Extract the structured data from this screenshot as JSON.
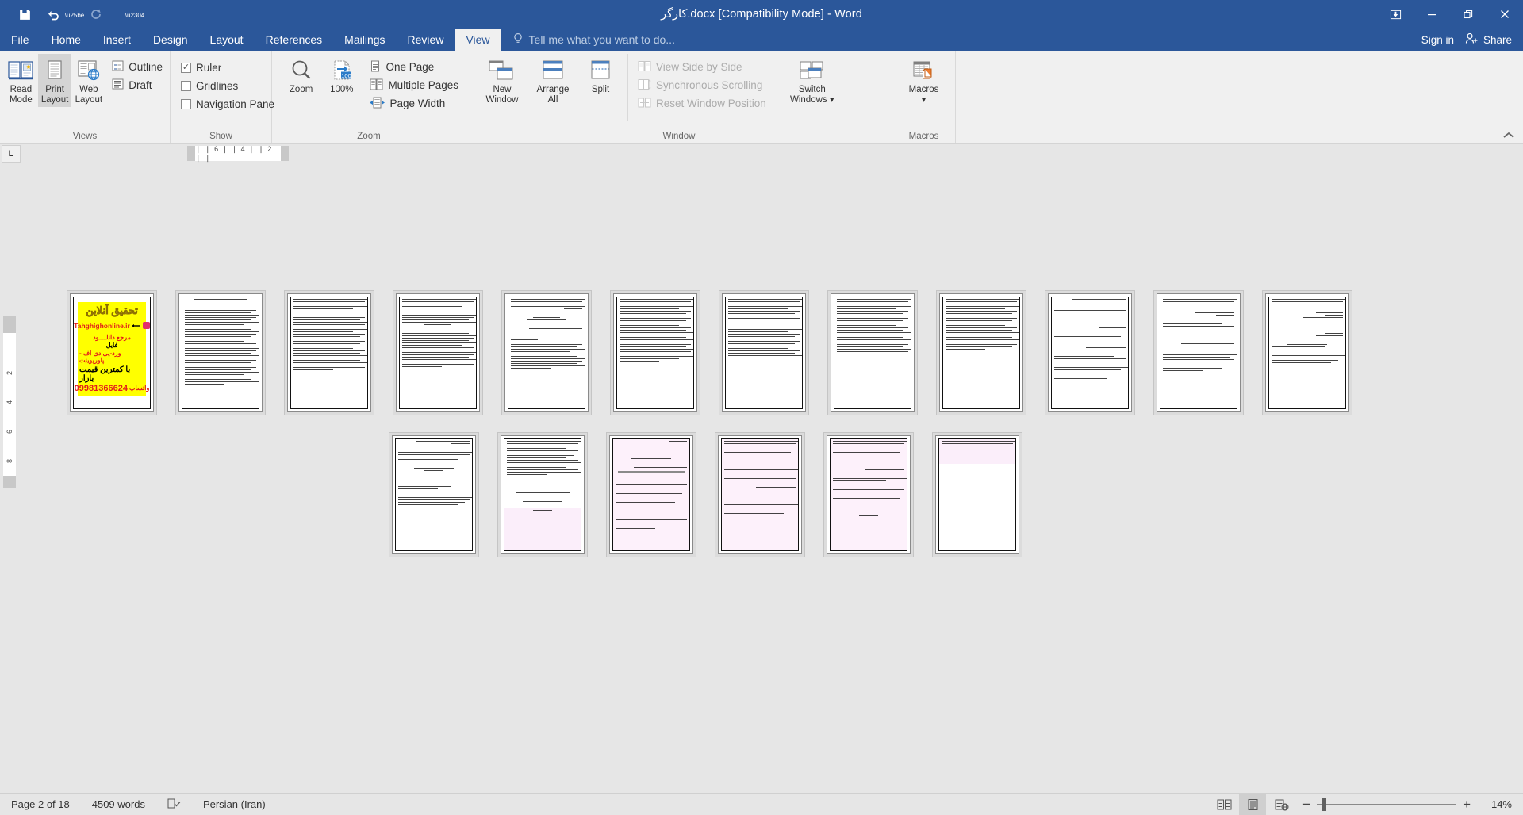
{
  "window": {
    "title": "کارگر.docx [Compatibility Mode] - Word",
    "quick_access": [
      {
        "name": "save",
        "glyph": "💾"
      },
      {
        "name": "undo",
        "glyph": "↶"
      },
      {
        "name": "redo",
        "glyph": "↻"
      },
      {
        "name": "customize",
        "glyph": "⌄"
      }
    ],
    "controls": {
      "ribbon_display_options": "⬆",
      "minimize": "—",
      "restore": "❐",
      "close": "✕"
    }
  },
  "tabs": [
    {
      "label": "File",
      "active": false
    },
    {
      "label": "Home",
      "active": false
    },
    {
      "label": "Insert",
      "active": false
    },
    {
      "label": "Design",
      "active": false
    },
    {
      "label": "Layout",
      "active": false
    },
    {
      "label": "References",
      "active": false
    },
    {
      "label": "Mailings",
      "active": false
    },
    {
      "label": "Review",
      "active": false
    },
    {
      "label": "View",
      "active": true
    }
  ],
  "tellme": {
    "placeholder": "Tell me what you want to do...",
    "icon": "lightbulb-icon"
  },
  "account": {
    "signin": "Sign in",
    "share": "Share"
  },
  "ribbon": {
    "collapse_glyph": "⌃",
    "groups": [
      {
        "label": "Views",
        "big_buttons": [
          {
            "label1": "Read",
            "label2": "Mode",
            "name": "read-mode",
            "selected": false
          },
          {
            "label1": "Print",
            "label2": "Layout",
            "name": "print-layout",
            "selected": true
          },
          {
            "label1": "Web",
            "label2": "Layout",
            "name": "web-layout",
            "selected": false
          }
        ],
        "small_items": [
          {
            "label": "Outline",
            "name": "outline",
            "type": "icon"
          },
          {
            "label": "Draft",
            "name": "draft",
            "type": "icon"
          }
        ]
      },
      {
        "label": "Show",
        "small_items": [
          {
            "label": "Ruler",
            "name": "ruler",
            "type": "check",
            "checked": true
          },
          {
            "label": "Gridlines",
            "name": "gridlines",
            "type": "check",
            "checked": false
          },
          {
            "label": "Navigation Pane",
            "name": "navigation-pane",
            "type": "check",
            "checked": false
          }
        ]
      },
      {
        "label": "Zoom",
        "big_buttons": [
          {
            "label1": "Zoom",
            "label2": "",
            "name": "zoom",
            "selected": false
          },
          {
            "label1": "100%",
            "label2": "",
            "name": "zoom-100",
            "selected": false
          }
        ],
        "small_items": [
          {
            "label": "One Page",
            "name": "one-page",
            "type": "icon"
          },
          {
            "label": "Multiple Pages",
            "name": "multiple-pages",
            "type": "icon"
          },
          {
            "label": "Page Width",
            "name": "page-width",
            "type": "icon"
          }
        ]
      },
      {
        "label": "Window",
        "big_buttons": [
          {
            "label1": "New",
            "label2": "Window",
            "name": "new-window",
            "selected": false
          },
          {
            "label1": "Arrange",
            "label2": "All",
            "name": "arrange-all",
            "selected": false
          },
          {
            "label1": "Split",
            "label2": "",
            "name": "split",
            "selected": false
          },
          {
            "label1": "Switch",
            "label2": "Windows ▾",
            "name": "switch-windows",
            "selected": false
          }
        ],
        "small_items": [
          {
            "label": "View Side by Side",
            "name": "view-side-by-side",
            "type": "icon",
            "disabled": true
          },
          {
            "label": "Synchronous Scrolling",
            "name": "synchronous-scrolling",
            "type": "icon",
            "disabled": true
          },
          {
            "label": "Reset Window Position",
            "name": "reset-window-position",
            "type": "icon",
            "disabled": true
          }
        ]
      },
      {
        "label": "Macros",
        "big_buttons": [
          {
            "label1": "Macros",
            "label2": "▾",
            "name": "macros",
            "selected": false
          }
        ],
        "small_items": []
      }
    ]
  },
  "rulers": {
    "tab_selector": "L",
    "horizontal_ticks": "❘ ❘ 6 ❘  ❘ 4 ❘  ❘ 2 ❘  ❘",
    "vertical_ticks": [
      "",
      "2",
      "4",
      "6",
      "8",
      ""
    ]
  },
  "document": {
    "zoom_percent": "14%",
    "rows": [
      {
        "pages": [
          {
            "n": 1,
            "kind": "ad",
            "selected": true
          },
          {
            "n": 2,
            "kind": "dense",
            "selected": true
          },
          {
            "n": 3,
            "kind": "dense",
            "selected": true
          },
          {
            "n": 4,
            "kind": "dense",
            "selected": true
          },
          {
            "n": 5,
            "kind": "dense",
            "selected": true
          },
          {
            "n": 6,
            "kind": "dense",
            "selected": true
          },
          {
            "n": 7,
            "kind": "dense",
            "selected": true
          },
          {
            "n": 8,
            "kind": "dense",
            "selected": true
          },
          {
            "n": 9,
            "kind": "dense",
            "selected": true
          },
          {
            "n": 10,
            "kind": "sparse",
            "selected": true
          },
          {
            "n": 11,
            "kind": "sparse",
            "selected": true
          },
          {
            "n": 12,
            "kind": "sparse",
            "selected": true
          }
        ]
      },
      {
        "pages": [
          {
            "n": 13,
            "kind": "sparse",
            "selected": true
          },
          {
            "n": 14,
            "kind": "tintedhalf",
            "selected": true
          },
          {
            "n": 15,
            "kind": "tinted",
            "selected": true
          },
          {
            "n": 16,
            "kind": "tinted",
            "selected": true
          },
          {
            "n": 17,
            "kind": "tinted",
            "selected": true
          },
          {
            "n": 18,
            "kind": "tintedtop",
            "selected": true
          }
        ]
      }
    ],
    "advertisement": {
      "headline": "تحقیق آنلاین",
      "url": "Tahghighonline.ir",
      "line1": "مرجع دانلــــود",
      "line2": "فایل",
      "line3": "ورد-پی دی اف - پاورپوینت",
      "line4": "با کمترین قیمت بازار",
      "phone": "09981366624",
      "whatsapp": "واتساپ"
    }
  },
  "status": {
    "page": "Page 2 of 18",
    "words": "4509 words",
    "proofing_icon": "proofing-icon",
    "language": "Persian (Iran)",
    "view_buttons": [
      {
        "name": "read-mode-view",
        "glyph": "☷",
        "active": false
      },
      {
        "name": "print-layout-view",
        "glyph": "▤",
        "active": true
      },
      {
        "name": "web-layout-view",
        "glyph": "ἱ0",
        "active": false
      }
    ],
    "zoom_out": "−",
    "zoom_in": "+",
    "zoom_value": "14%"
  },
  "colors": {
    "brand": "#2b579a",
    "ribbon_bg": "#f0f0f0",
    "workspace": "#e6e6e6",
    "ad_bg": "#ffff00",
    "ad_red": "#e21b1b",
    "tint": "#fdf1fb"
  }
}
